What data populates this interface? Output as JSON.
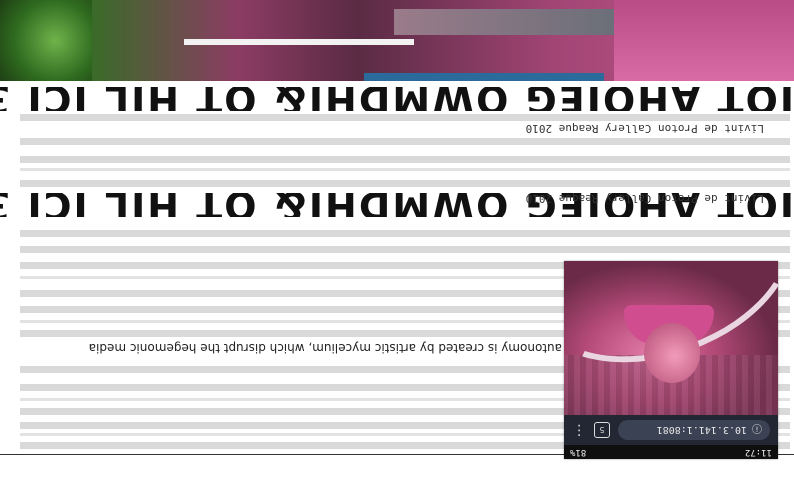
{
  "phone": {
    "status_time": "11:72",
    "status_battery": "81%",
    "url": "10.3.141.1:8081",
    "tab_count": "5"
  },
  "article": {
    "credit_1": "Livint de Proton Callery Reaque 2010",
    "credit_2": "Livint de Proton Callery Reaque 2010",
    "body_line": "autonomy is created by artistic mycelium, which disrupt the hegemonic media",
    "headline_glyphs": "JOT AHOJEG OWMDHJ& OT HJL ICJ 30CJ"
  },
  "colors": {
    "accent_pink": "#c35a8e",
    "browser_bar": "#232733"
  }
}
